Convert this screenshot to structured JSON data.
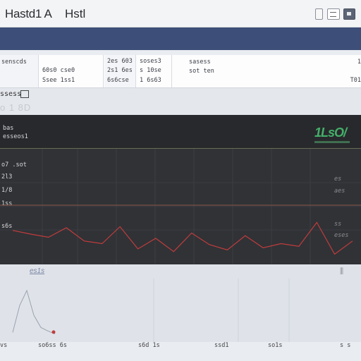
{
  "window": {
    "title": "Hastd1 A",
    "tab": "Hstl"
  },
  "panel": {
    "cells": [
      {
        "line1": "senscds",
        "line2": ""
      },
      {
        "line1": "60s0 cse0",
        "line2": "Ssee 1ss1"
      },
      {
        "line1": "2es 603",
        "line2": "2s1 6es",
        "line3": "6s6cse"
      },
      {
        "line1": "soses3",
        "line2": "s 10se",
        "line3": "1 6s63"
      },
      {
        "line1": "sasess",
        "line2": "sot ten",
        "right1": "1",
        "right2": "T01"
      }
    ]
  },
  "subtool": {
    "label": "ssess",
    "label2": "o 1 8D"
  },
  "dark_chart": {
    "header_labels": [
      "bas",
      "esseos1"
    ],
    "y_labels": [
      "o7 .sot",
      "2l3",
      "1/8",
      "1ss",
      "s6s"
    ],
    "right_labels": [
      "es",
      "aes",
      "ss",
      "eses"
    ],
    "brand": "1LsO/"
  },
  "light_chart": {
    "label": "es1s",
    "icon": "chart-options-icon"
  },
  "footer": {
    "ticks": [
      "vs",
      "so6ss 6s",
      "s6d 1s",
      "ssd1",
      "so1s",
      "s s"
    ]
  },
  "colors": {
    "toolbar": "#3d4f78",
    "dark_bg": "#303236",
    "red_line": "#c23c3c",
    "brand_green": "#44b06a"
  },
  "chart_data": {
    "type": "line",
    "series": [
      {
        "values": [
          0.55,
          0.48,
          0.42,
          0.6,
          0.35,
          0.3,
          0.62,
          0.2,
          0.4,
          0.15,
          0.5,
          0.28,
          0.18,
          0.45,
          0.22,
          0.3,
          0.25,
          0.7,
          0.1,
          0.35
        ]
      },
      {
        "values": [
          0.05,
          0.6,
          0.9,
          0.4,
          0.15,
          0.08,
          0.02
        ]
      }
    ],
    "grid": true
  }
}
